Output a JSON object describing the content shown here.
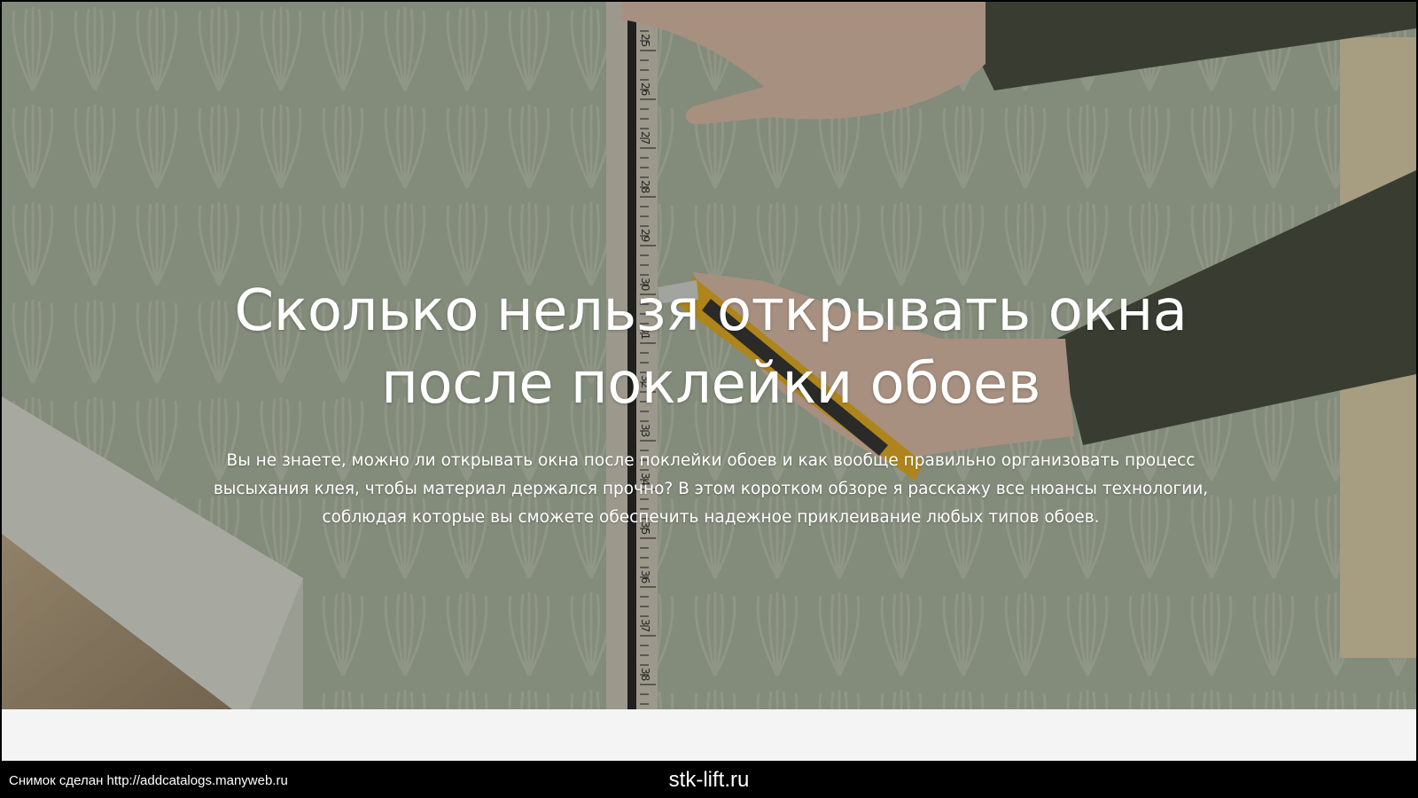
{
  "hero": {
    "headline_line1": "Сколько нельзя открывать окна",
    "headline_line2": "после поклейки обоев",
    "lead_line1": "Вы не знаете, можно ли открывать окна после поклейки обоев и как вообще правильно организовать процесс",
    "lead_line2": "высыхания клея, чтобы материал держался прочно? В этом коротком обзоре я расскажу все нюансы технологии,",
    "lead_line3": "соблюдая которые вы сможете обеспечить надежное приклеивание любых типов обоев.",
    "ruler_marks": [
      "25",
      "26",
      "27",
      "28",
      "29",
      "30",
      "31",
      "32",
      "33",
      "34",
      "35",
      "36",
      "37",
      "38"
    ]
  },
  "caption": {
    "left": "Снимок сделан http://addcatalogs.manyweb.ru",
    "center": "stk-lift.ru"
  },
  "colors": {
    "wallpaper": "#a4ad98",
    "sleeve": "#3f4337",
    "skin": "#d9b8a4",
    "cutter": "#e2a819",
    "ruler": "#c9c3b5"
  }
}
